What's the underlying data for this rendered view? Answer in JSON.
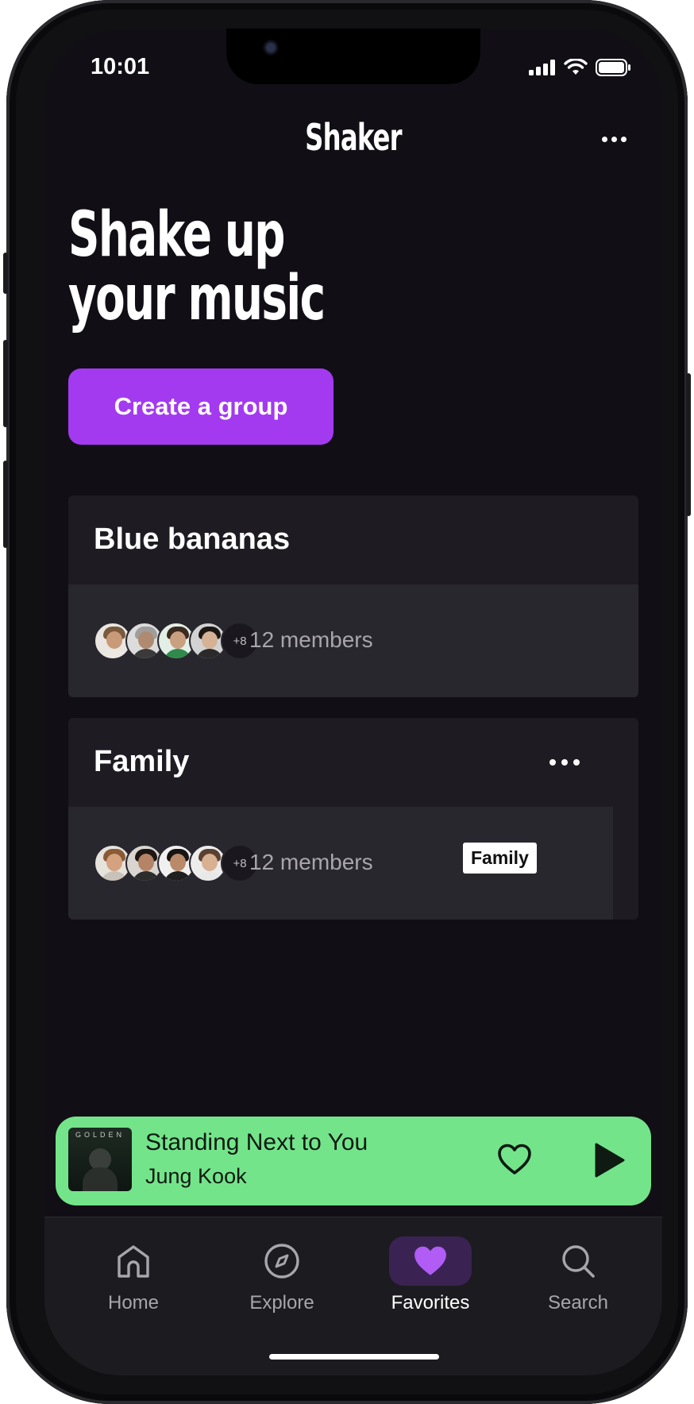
{
  "status": {
    "time": "10:01"
  },
  "app": {
    "title": "Shaker"
  },
  "hero": {
    "line1": "Shake up",
    "line2": "your music"
  },
  "create_button": {
    "label": "Create a group"
  },
  "groups": [
    {
      "name": "Blue bananas",
      "extra_count": "+8",
      "members": "12 members"
    },
    {
      "name": "Family",
      "extra_count": "+8",
      "members": "12 members",
      "badge": "Family"
    }
  ],
  "player": {
    "album_text": "GOLDEN",
    "title": "Standing Next to You",
    "artist": "Jung Kook"
  },
  "tabs": [
    {
      "label": "Home",
      "icon": "home-icon"
    },
    {
      "label": "Explore",
      "icon": "compass-icon"
    },
    {
      "label": "Favorites",
      "icon": "heart-icon",
      "active": true
    },
    {
      "label": "Search",
      "icon": "search-icon"
    }
  ],
  "colors": {
    "accent": "#a33af0",
    "player_bg": "#74e48a",
    "background": "#110f15",
    "card": "#1e1c22"
  }
}
